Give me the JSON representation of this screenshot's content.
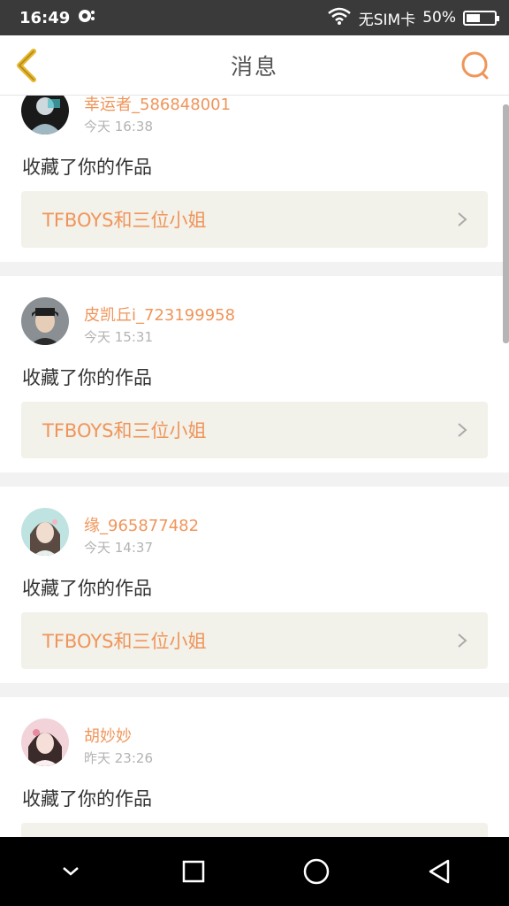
{
  "status_bar": {
    "time": "16:49",
    "carrier": "无SIM卡",
    "battery": "50%",
    "battery_level": 0.5
  },
  "app_bar": {
    "title": "消息",
    "back_icon": "chevron-left-icon",
    "search_icon": "search-icon"
  },
  "colors": {
    "accent": "#f0955a",
    "back_accent": "#e8b52a"
  },
  "messages": [
    {
      "username": "幸运者_586848001",
      "time": "今天 16:38",
      "action": "收藏了你的作品",
      "work_title": "TFBOYS和三位小姐"
    },
    {
      "username": "皮凯丘i_723199958",
      "time": "今天 15:31",
      "action": "收藏了你的作品",
      "work_title": "TFBOYS和三位小姐"
    },
    {
      "username": "缘_965877482",
      "time": "今天 14:37",
      "action": "收藏了你的作品",
      "work_title": "TFBOYS和三位小姐"
    },
    {
      "username": "胡妙妙",
      "time": "昨天 23:26",
      "action": "收藏了你的作品",
      "work_title": ""
    }
  ]
}
